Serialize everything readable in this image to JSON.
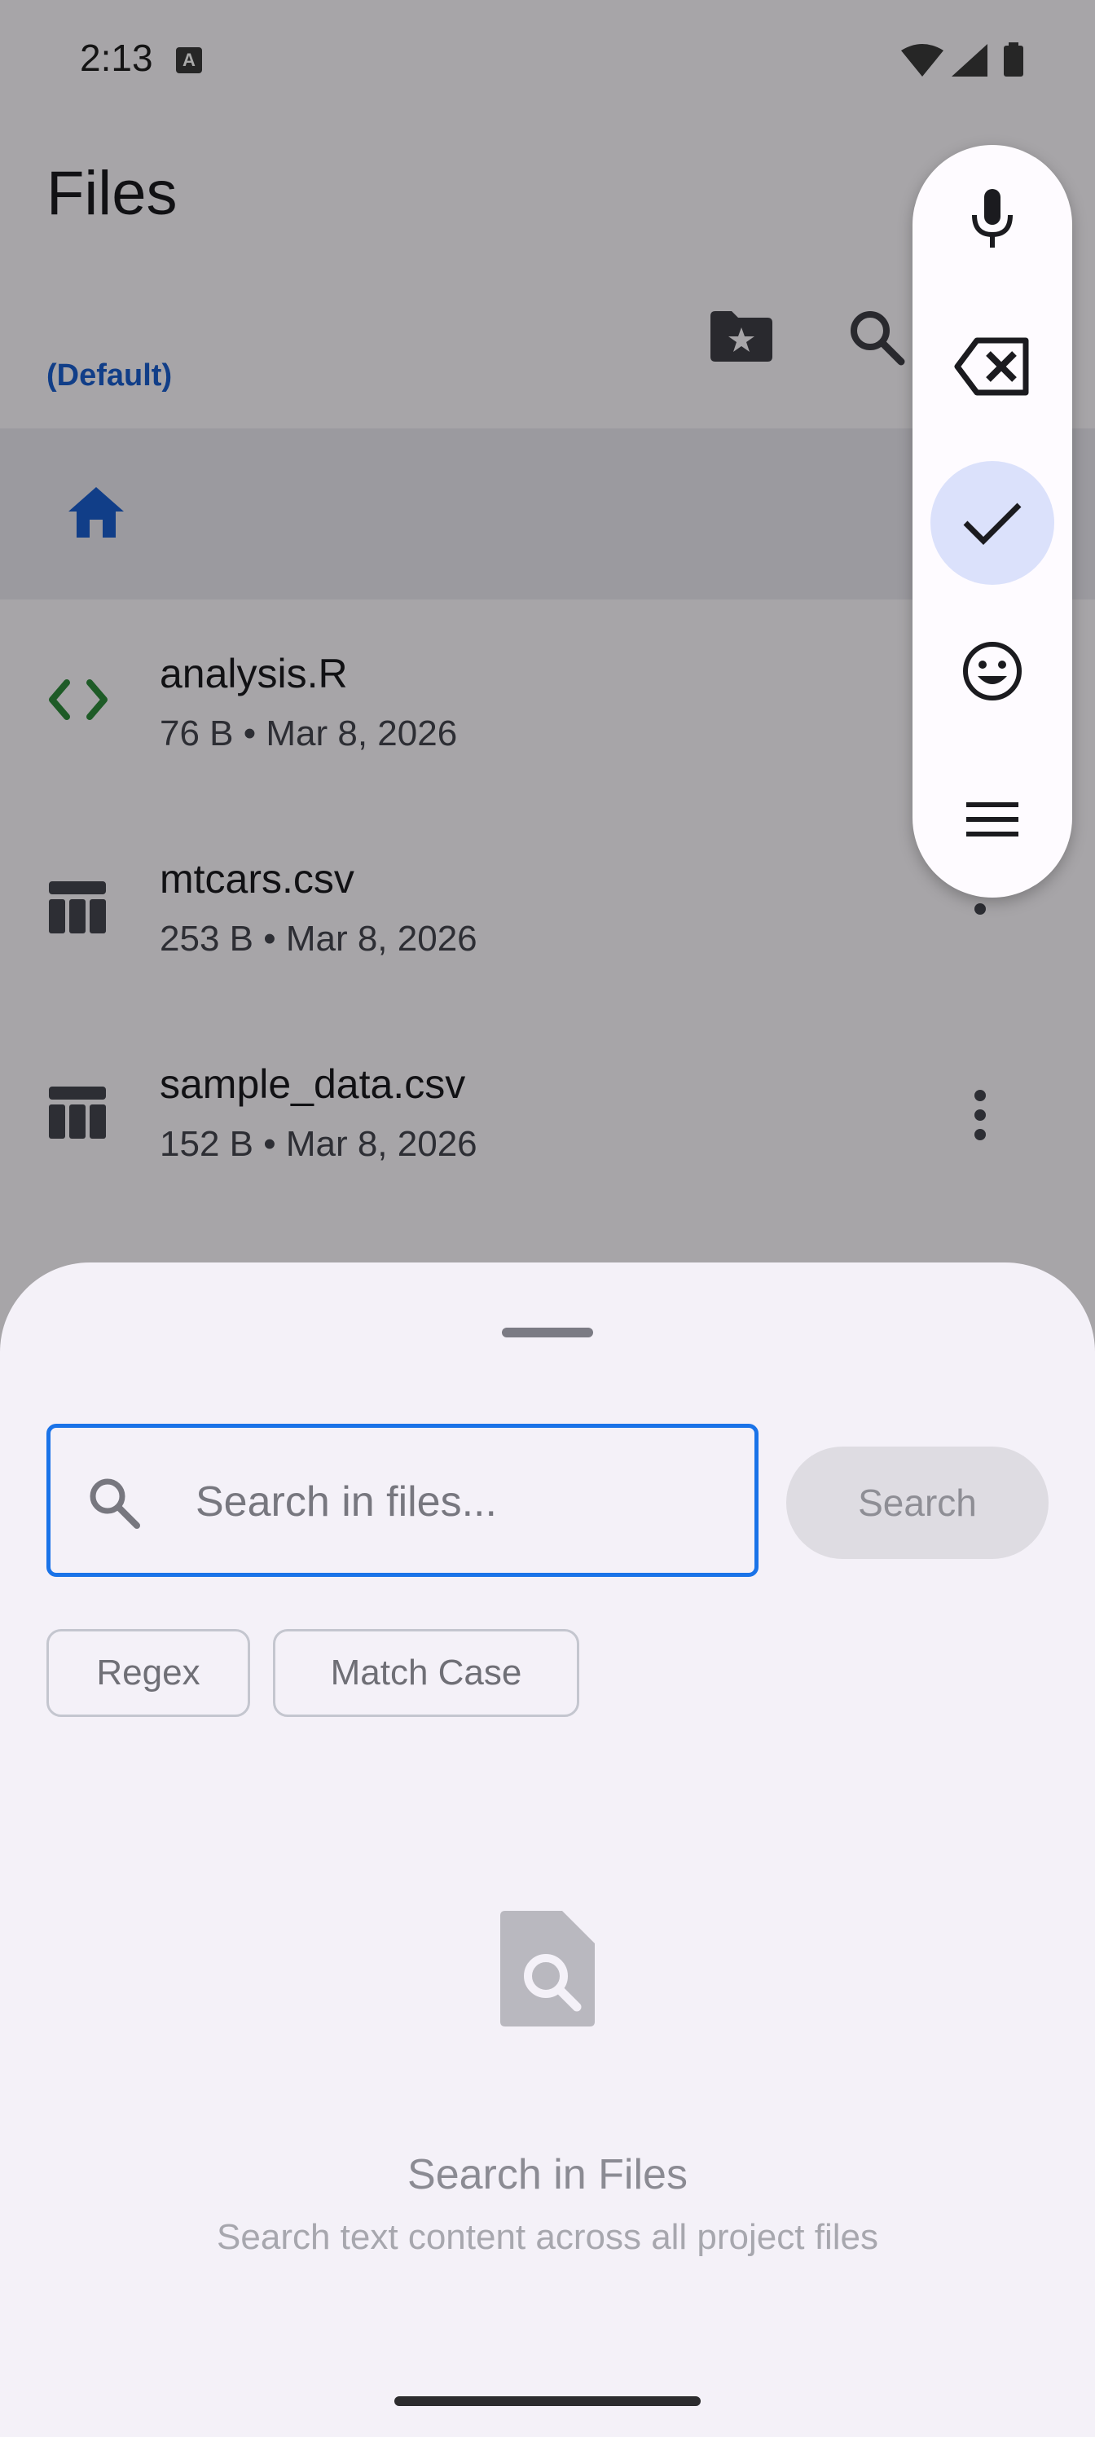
{
  "status_bar": {
    "time": "2:13",
    "notification_glyph": "A"
  },
  "header": {
    "title": "Files",
    "subtitle": "(Default)"
  },
  "files": [
    {
      "name": "analysis.R",
      "meta": "76 B • Mar 8, 2026",
      "icon": "code-icon"
    },
    {
      "name": "mtcars.csv",
      "meta": "253 B • Mar 8, 2026",
      "icon": "table-icon"
    },
    {
      "name": "sample_data.csv",
      "meta": "152 B • Mar 8, 2026",
      "icon": "table-icon"
    }
  ],
  "keyboard_toolbar": [
    "mic-icon",
    "backspace-icon",
    "check-icon",
    "emoji-icon",
    "menu-icon"
  ],
  "search_sheet": {
    "placeholder": "Search in files...",
    "search_button": "Search",
    "chips": [
      "Regex",
      "Match Case"
    ],
    "empty_title": "Search in Files",
    "empty_description": "Search text content across all project files"
  },
  "colors": {
    "accent": "#1a73e8",
    "code_icon": "#2e8b3c",
    "home_icon": "#1a5fcf"
  }
}
